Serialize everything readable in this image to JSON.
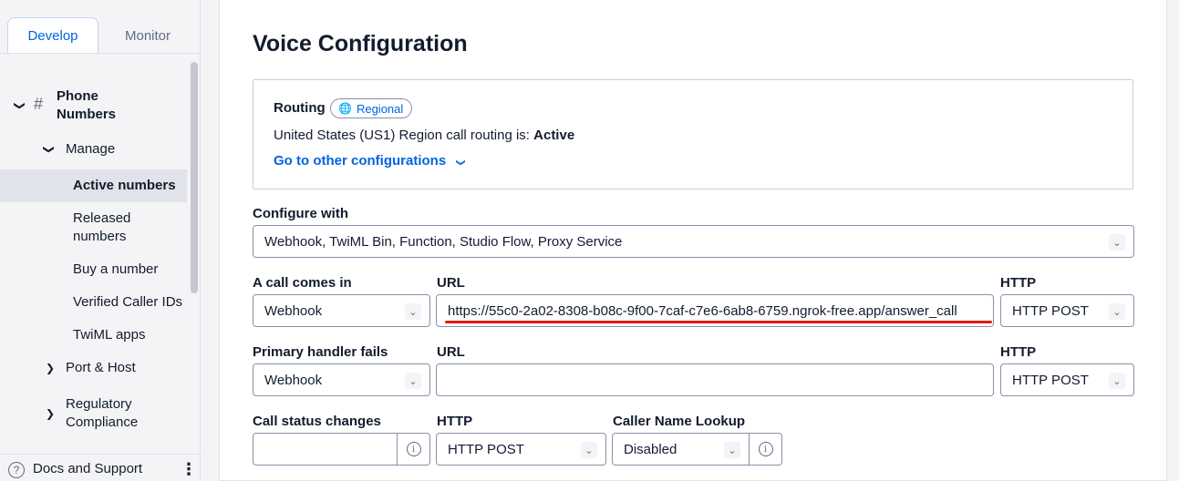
{
  "sidebar": {
    "tabs": [
      "Develop",
      "Monitor"
    ],
    "phone_numbers": "Phone Numbers",
    "phone_numbers_line1": "Phone",
    "phone_numbers_line2": "Numbers",
    "manage": "Manage",
    "items": [
      "Active numbers",
      "Released numbers",
      "Buy a number",
      "Verified Caller IDs",
      "TwiML apps"
    ],
    "released_line1": "Released",
    "released_line2": "numbers",
    "port_host": "Port & Host",
    "regulatory_line1": "Regulatory",
    "regulatory_line2": "Compliance",
    "footer": "Docs and Support"
  },
  "main": {
    "title": "Voice Configuration",
    "routing": {
      "label": "Routing",
      "badge": "Regional",
      "status_prefix": "United States (US1) Region call routing is:",
      "status_value": "Active",
      "link": "Go to other configurations"
    },
    "configure_with": {
      "label": "Configure with",
      "value": "Webhook, TwiML Bin, Function, Studio Flow, Proxy Service"
    },
    "call_comes_in": {
      "label": "A call comes in",
      "type": "Webhook",
      "url_label": "URL",
      "url": "https://55c0-2a02-8308-b08c-9f00-7caf-c7e6-6ab8-6759.ngrok-free.app/answer_call",
      "http_label": "HTTP",
      "http": "HTTP POST"
    },
    "primary_fails": {
      "label": "Primary handler fails",
      "type": "Webhook",
      "url_label": "URL",
      "url": "",
      "http_label": "HTTP",
      "http": "HTTP POST"
    },
    "status_changes": {
      "label": "Call status changes",
      "value": "",
      "http_label": "HTTP",
      "http": "HTTP POST",
      "caller_lookup_label": "Caller Name Lookup",
      "caller_lookup": "Disabled"
    }
  },
  "colors": {
    "accent": "#0263e0",
    "highlight": "#e31b0c"
  }
}
